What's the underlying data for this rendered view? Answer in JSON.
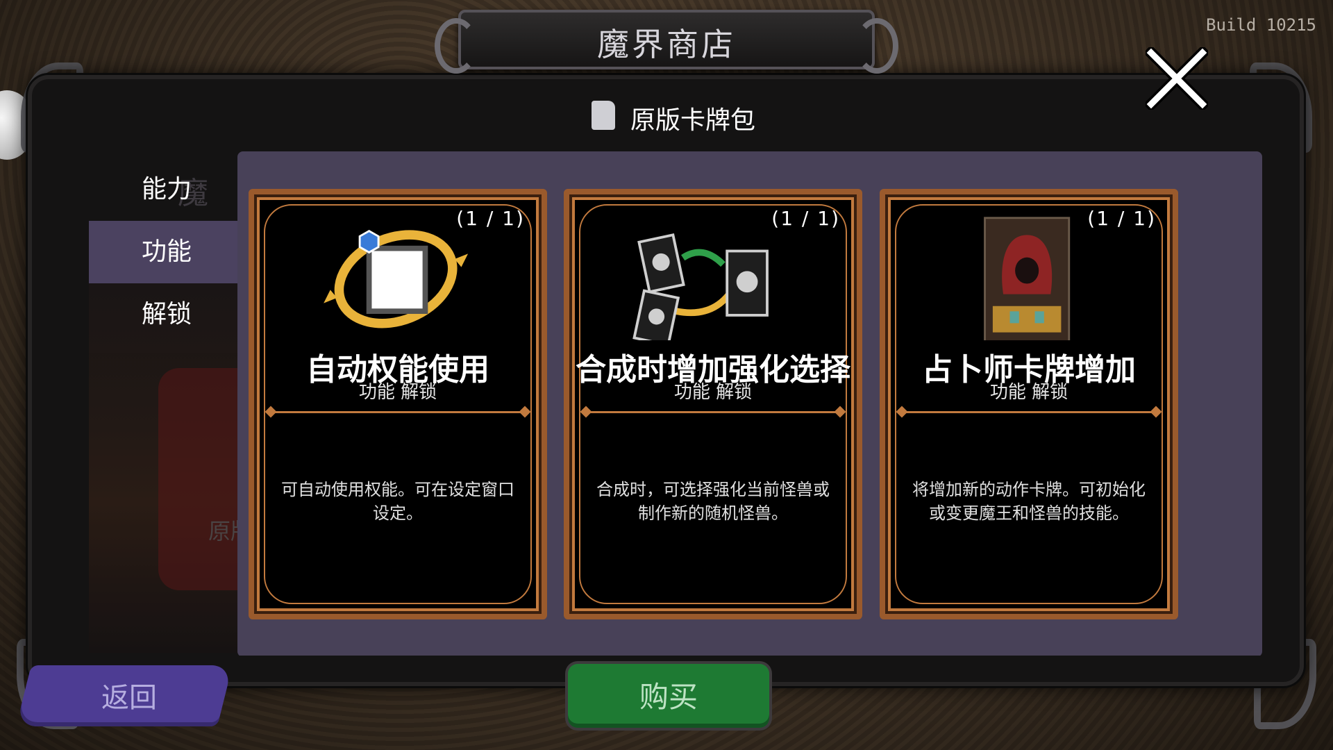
{
  "header": {
    "title": "魔界商店",
    "build": "Build 10215"
  },
  "category": {
    "title": "原版卡牌包"
  },
  "sidebar": {
    "tabs": [
      {
        "label": "能力",
        "active": false
      },
      {
        "label": "功能",
        "active": true
      },
      {
        "label": "解锁",
        "active": false
      }
    ],
    "faded_bg_text": "魔石",
    "faded_label": "原版"
  },
  "cards": [
    {
      "count": "(1 / 1)",
      "name": "自动权能使用",
      "type": "功能 解锁",
      "description": "可自动使用权能。可在设定窗口设定。",
      "icon": "auto-cycle-icon"
    },
    {
      "count": "(1 / 1)",
      "name": "合成时增加强化选择",
      "type": "功能 解锁",
      "description": "合成时，可选择强化当前怪兽或制作新的随机怪兽。",
      "icon": "merge-cards-icon"
    },
    {
      "count": "(1 / 1)",
      "name": "占卜师卡牌增加",
      "type": "功能 解锁",
      "description": "将增加新的动作卡牌。可初始化或变更魔王和怪兽的技能。",
      "icon": "fortune-teller-card-icon"
    }
  ],
  "buttons": {
    "back": "返回",
    "buy": "购买"
  },
  "colors": {
    "board": "#484158",
    "card_border": "#c27a3e",
    "active_tab": "#4b4260",
    "back_button": "#4d3c93",
    "buy_button": "#1e7a33"
  }
}
